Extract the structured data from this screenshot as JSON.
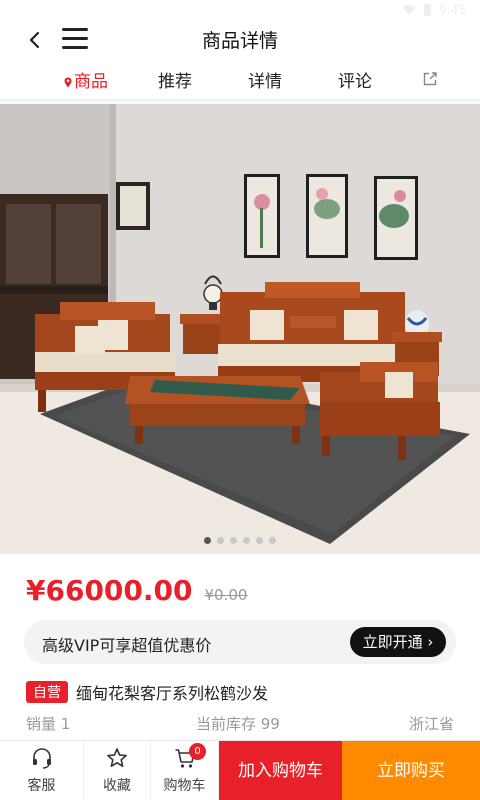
{
  "status": {
    "time": "9:45"
  },
  "header": {
    "title": "商品详情"
  },
  "tabs": [
    {
      "label": "商品"
    },
    {
      "label": "推荐"
    },
    {
      "label": "详情"
    },
    {
      "label": "评论"
    }
  ],
  "carousel": {
    "total": 6,
    "current": 1
  },
  "price": {
    "current": "¥66000.00",
    "original": "¥0.00"
  },
  "vip": {
    "text": "高级VIP可享超值优惠价",
    "button": "立即开通 ›"
  },
  "product": {
    "badge": "自营",
    "name": "缅甸花梨客厅系列松鹤沙发"
  },
  "meta": {
    "sales": "销量 1",
    "stock": "当前库存 99",
    "region": "浙江省"
  },
  "bottom": {
    "service": "客服",
    "favorite": "收藏",
    "cart": "购物车",
    "cart_count": "0",
    "add_to_cart": "加入购物车",
    "buy_now": "立即购买"
  },
  "colors": {
    "accent": "#e8202a",
    "buy": "#ff8a00",
    "vip_button": "#111111"
  },
  "icons": [
    "wifi-icon",
    "battery-icon",
    "back-icon",
    "menu-icon",
    "location-pin-icon",
    "share-icon",
    "headset-icon",
    "star-icon",
    "cart-icon"
  ]
}
